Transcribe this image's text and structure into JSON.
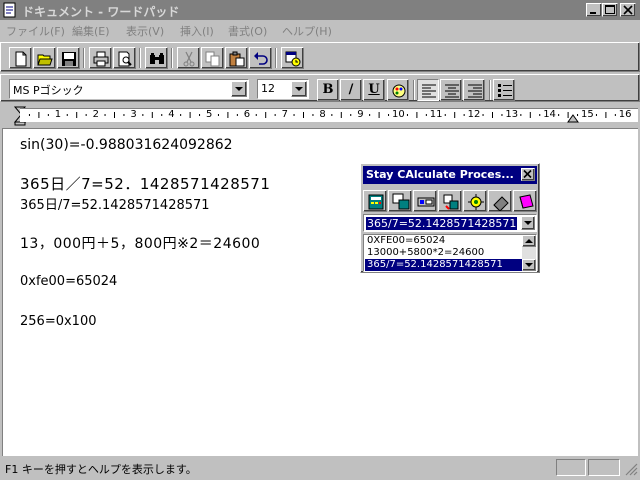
{
  "window": {
    "title": "ドキュメント - ワードパッド",
    "icons": [
      "document-icon",
      "minimize-icon",
      "maximize-icon",
      "close-icon"
    ]
  },
  "menu": {
    "items": [
      "ファイル(F)",
      "編集(E)",
      "表示(V)",
      "挿入(I)",
      "書式(O)",
      "ヘルプ(H)"
    ]
  },
  "toolbar": {
    "icons": [
      "new-icon",
      "open-icon",
      "save-icon",
      "print-icon",
      "print-preview-icon",
      "find-icon",
      "cut-icon",
      "copy-icon",
      "paste-icon",
      "undo-icon",
      "insert-datetime-icon"
    ]
  },
  "format": {
    "font": "MS Pゴシック",
    "size": "12",
    "bold_label": "B",
    "italic_label": "/",
    "underline_label": "U"
  },
  "ruler": {
    "numbers": [
      "1",
      "2",
      "3",
      "4",
      "5",
      "6",
      "7",
      "8",
      "9",
      "10",
      "11",
      "12",
      "13",
      "14",
      "15",
      "16"
    ]
  },
  "document": {
    "lines": [
      "sin(30)=-0.988031624092862",
      "365日／7=52．1428571428571",
      "365日/7=52.1428571428571",
      "13，000円＋5，800円※2＝24600",
      "0xfe00=65024",
      "256=0x100"
    ]
  },
  "status": {
    "text": "F1 キーを押すとヘルプを表示します。"
  },
  "calc": {
    "title": "Stay CAlculate Proces...",
    "input_value": "365/7=52.1428571428571",
    "history": [
      "0XFE00=65024",
      "13000+5800*2=24600",
      "365/7=52.1428571428571"
    ]
  },
  "colors": {
    "face": "#c0c0c0",
    "active_title": "#000080",
    "inactive_title": "#808080",
    "selection": "#000080"
  }
}
